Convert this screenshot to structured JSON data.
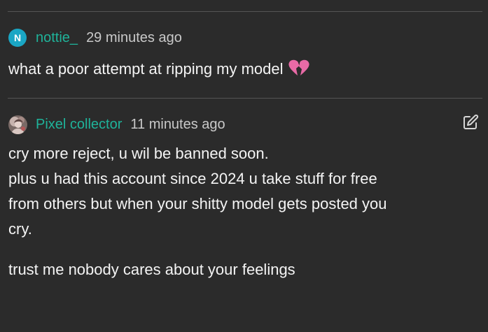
{
  "comments": [
    {
      "avatar_initial": "N",
      "author": "nottie_",
      "time": "29 minutes ago",
      "text": "what a poor attempt at ripping my model",
      "emoji_icon": "broken-heart-icon"
    },
    {
      "author": "Pixel collector",
      "time": "11 minutes ago",
      "edit_icon": "edit-icon",
      "lines": [
        "cry more reject, u wil be banned soon.",
        "plus u had this account since 2024 u take stuff for free",
        "from others but when your shitty model gets posted you",
        "cry."
      ],
      "second_paragraph": "trust me nobody cares about your feelings"
    }
  ],
  "colors": {
    "background": "#2b2b2b",
    "author": "#1fb39a",
    "avatar_n": "#1aa6c4",
    "heart": "#e86aa6"
  }
}
